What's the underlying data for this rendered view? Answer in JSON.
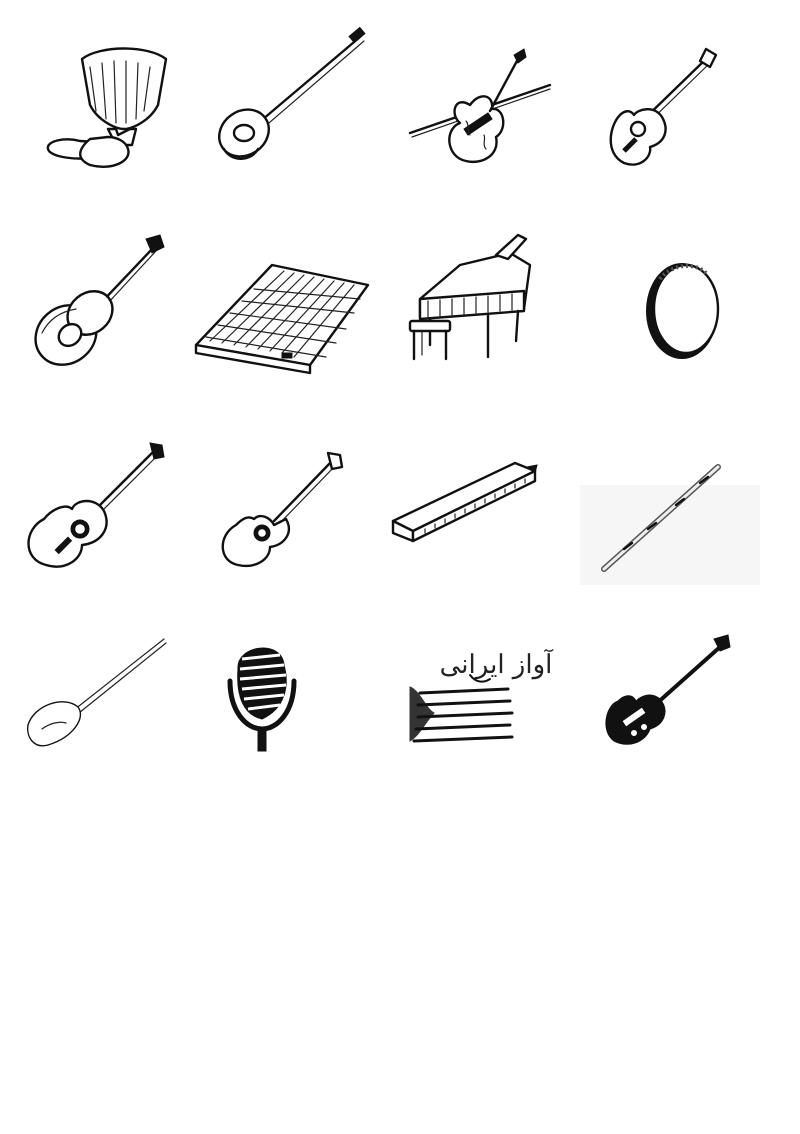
{
  "page": {
    "background": "#ffffff",
    "ink_color": "#111111"
  },
  "icons": [
    {
      "icon": "tonbak-drum-icon"
    },
    {
      "icon": "setar-icon"
    },
    {
      "icon": "violin-icon"
    },
    {
      "icon": "classical-guitar-icon"
    },
    {
      "icon": "tar-icon"
    },
    {
      "icon": "santur-icon"
    },
    {
      "icon": "grand-piano-icon"
    },
    {
      "icon": "daf-frame-drum-icon"
    },
    {
      "icon": "acoustic-guitar-icon"
    },
    {
      "icon": "cutaway-guitar-icon"
    },
    {
      "icon": "harmonica-icon"
    },
    {
      "icon": "ney-flute-icon"
    },
    {
      "icon": "tanbur-icon"
    },
    {
      "icon": "microphone-icon"
    },
    {
      "icon": "avaz-irani-logo-icon"
    },
    {
      "icon": "electric-guitar-icon"
    }
  ],
  "logo": {
    "text": "آواز ایرانی"
  }
}
